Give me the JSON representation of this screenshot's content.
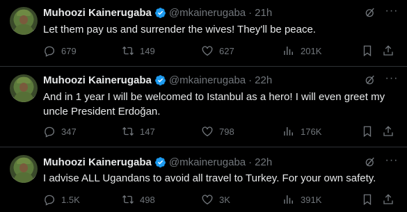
{
  "tweets": [
    {
      "author_name": "Muhoozi Kainerugaba",
      "handle": "@mkainerugaba",
      "separator": "·",
      "time": "21h",
      "text": "Let them pay us and surrender the wives! They'll be peace.",
      "replies": "679",
      "retweets": "149",
      "likes": "627",
      "views": "201K"
    },
    {
      "author_name": "Muhoozi Kainerugaba",
      "handle": "@mkainerugaba",
      "separator": "·",
      "time": "22h",
      "text": "And in 1 year I will be welcomed to Istanbul as a hero! I will even greet my uncle President Erdoğan.",
      "replies": "347",
      "retweets": "147",
      "likes": "798",
      "views": "176K"
    },
    {
      "author_name": "Muhoozi Kainerugaba",
      "handle": "@mkainerugaba",
      "separator": "·",
      "time": "22h",
      "text": "I advise ALL Ugandans to avoid all travel to Turkey. For your own safety.",
      "replies": "1.5K",
      "retweets": "498",
      "likes": "3K",
      "views": "391K"
    }
  ],
  "icons": {
    "verified": "verified-badge-icon",
    "grok": "grok-icon",
    "more": "more-options-icon",
    "reply": "reply-icon",
    "retweet": "retweet-icon",
    "like": "like-icon",
    "views": "views-icon",
    "bookmark": "bookmark-icon",
    "share": "share-icon"
  },
  "colors": {
    "background": "#000000",
    "text": "#e7e9ea",
    "muted": "#71767b",
    "verified": "#1d9bf0",
    "divider": "#2f3336"
  }
}
